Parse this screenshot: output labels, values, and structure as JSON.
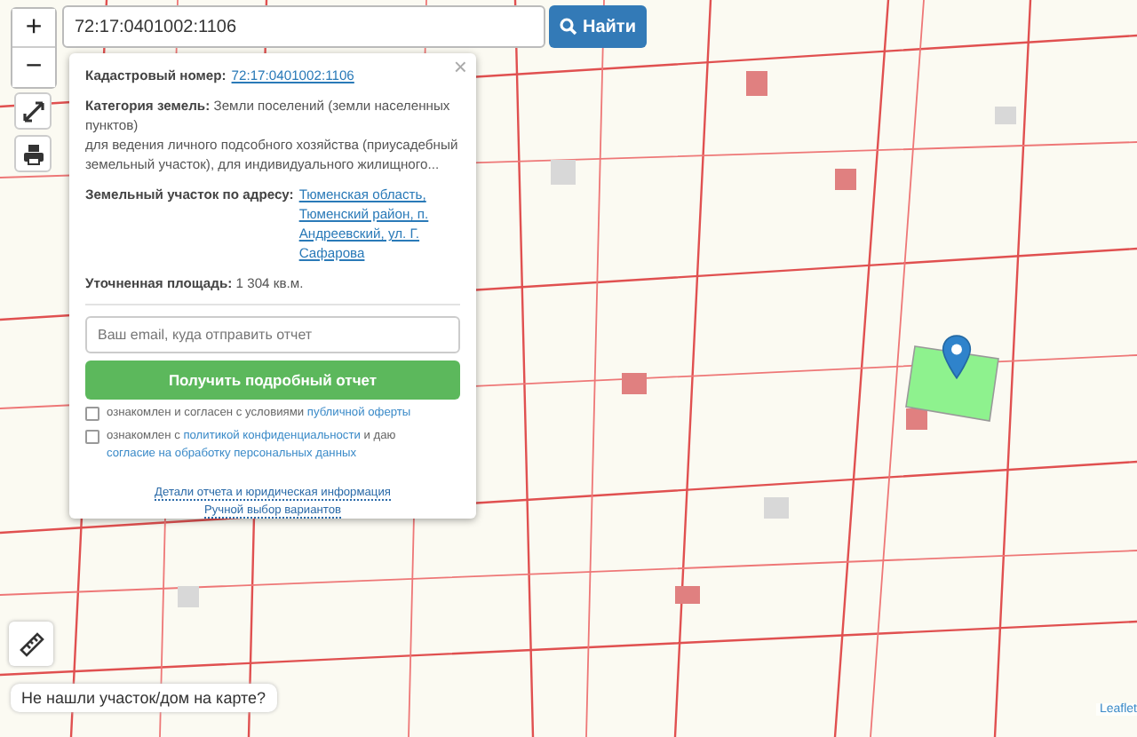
{
  "search": {
    "value": "72:17:0401002:1106",
    "button": "Найти"
  },
  "zoom": {
    "in": "+",
    "out": "−"
  },
  "popup": {
    "close": "×",
    "fields": [
      {
        "kind": "link",
        "label": "Кадастровый номер:",
        "value": "72:17:0401002:1106"
      },
      {
        "kind": "text",
        "label": "Категория земель:",
        "value": "Земли поселений (земли населенных пунктов)",
        "note": "для ведения личного подсобного хозяйства (приусадебный земельный участок), для индивидуального жилищного..."
      },
      {
        "kind": "link",
        "label": "Земельный участок по адресу:",
        "value": "Тюменская область, Тюменский район, п. Андреевский, ул. Г. Сафарова"
      },
      {
        "kind": "text",
        "label": "Уточненная площадь:",
        "value": "1 304 кв.м."
      }
    ],
    "email": {
      "placeholder": "Ваш email, куда отправить отчет"
    },
    "submit": "Получить подробный отчет",
    "agreements": [
      {
        "checked": false,
        "parts": [
          {
            "text": "ознакомлен и согласен с условиями ",
            "link": false
          },
          {
            "text": "публичной оферты",
            "link": true
          }
        ]
      },
      {
        "checked": false,
        "parts": [
          {
            "text": "ознакомлен с ",
            "link": false
          },
          {
            "text": "политикой конфиденциальности",
            "link": true
          },
          {
            "text": " и даю ",
            "link": false
          },
          {
            "text": "согласие на обработку персональных данных",
            "link": true
          }
        ]
      }
    ],
    "links": [
      "Детали отчета и юридическая информация",
      "Ручной выбор вариантов"
    ]
  },
  "not_found": "Не нашли участок/дом на карте?",
  "attribution": "Leaflet"
}
